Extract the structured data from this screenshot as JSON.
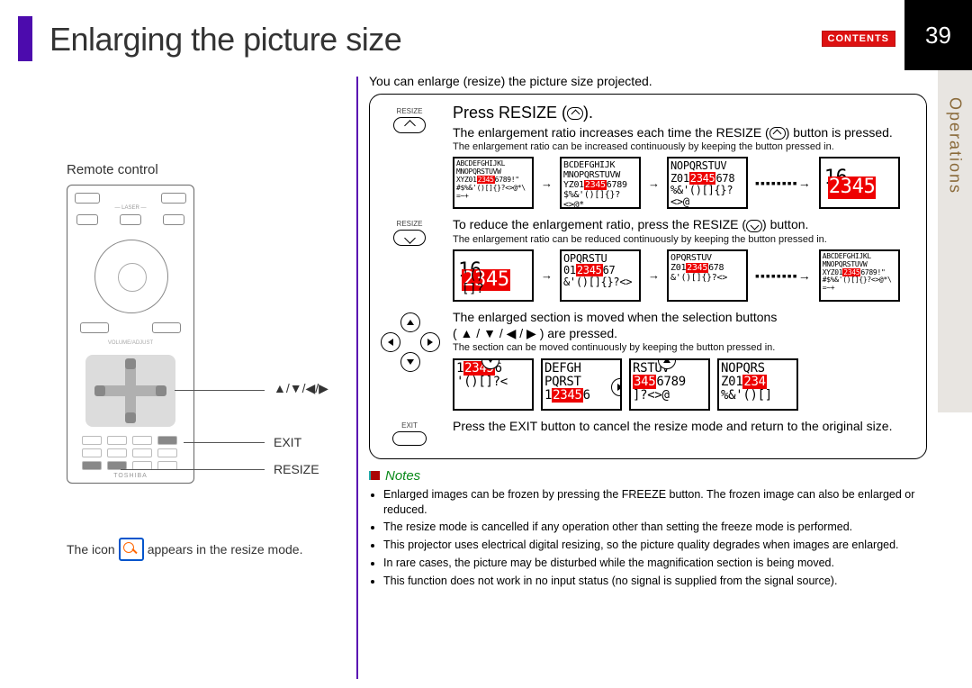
{
  "page": {
    "number": "39",
    "section": "Operations",
    "title": "Enlarging the picture size",
    "contents_label": "CONTENTS"
  },
  "intro": "You can enlarge (resize) the picture size projected.",
  "left": {
    "remote_label": "Remote control",
    "brand": "TOSHIBA",
    "callouts": {
      "arrows": "▲/▼/◀/▶",
      "exit": "EXIT",
      "resize": "RESIZE"
    },
    "icon_note_1": "The icon",
    "icon_note_2": "appears in the resize mode."
  },
  "box": {
    "step1": {
      "icon_label": "RESIZE",
      "title_a": "Press RESIZE (",
      "title_b": ").",
      "line1_a": "The enlargement ratio increases each time the RESIZE (",
      "line1_b": ") button is pressed.",
      "sub": "The enlargement ratio can be increased continuously by keeping the button pressed in."
    },
    "step2": {
      "icon_label": "RESIZE",
      "line1_a": "To reduce the enlargement ratio, press the RESIZE (",
      "line1_b": ") button.",
      "sub": "The enlargement ratio can be reduced continuously by keeping the button pressed in."
    },
    "step3": {
      "line1": "The enlarged section is moved when the selection buttons",
      "line2": "( ▲ / ▼ / ◀ / ▶ ) are pressed.",
      "sub": "The section can be moved continuously by keeping the button pressed in."
    },
    "step4": {
      "icon_label": "EXIT",
      "line": "Press the EXIT button to cancel the resize mode and return to the original size."
    }
  },
  "notes": {
    "heading": "Notes",
    "items": [
      "Enlarged images can be frozen by pressing the FREEZE button. The frozen image can also be enlarged or reduced.",
      "The resize mode is cancelled if any operation other than setting the freeze mode is performed.",
      "This projector uses electrical digital resizing, so the picture quality degrades when images are enlarged.",
      "In rare cases, the picture may be disturbed while the magnification section is being moved.",
      "This function does not work in no input status (no signal is supplied from the signal source)."
    ]
  }
}
